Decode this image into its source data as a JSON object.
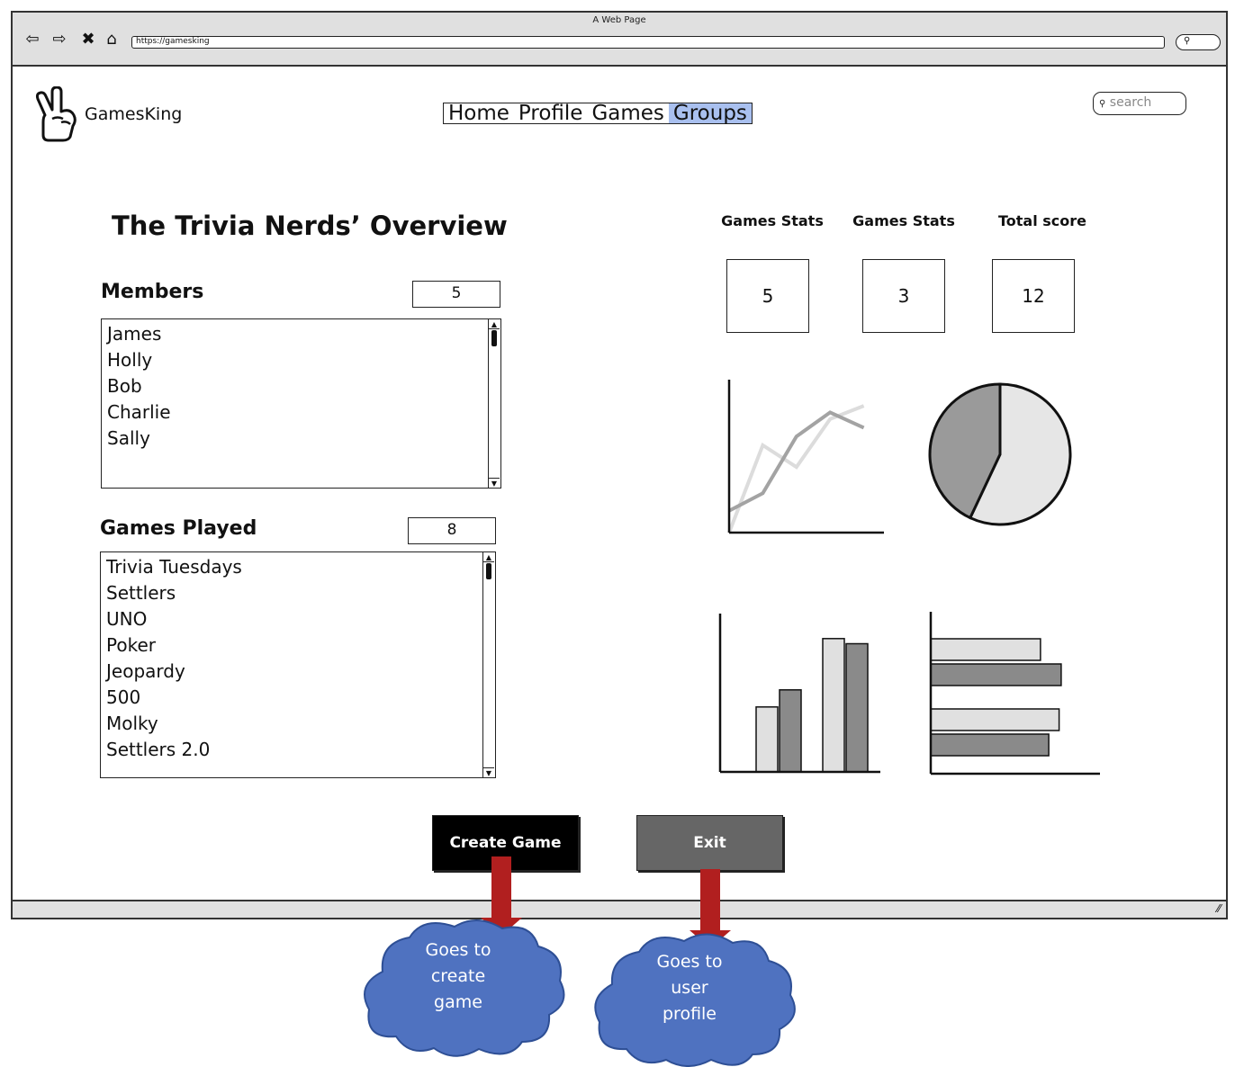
{
  "window": {
    "title": "A Web Page",
    "url": "https://gamesking"
  },
  "header": {
    "brand": "GamesKing",
    "nav": [
      {
        "label": "Home",
        "active": false
      },
      {
        "label": "Profile",
        "active": false
      },
      {
        "label": "Games",
        "active": false
      },
      {
        "label": "Groups",
        "active": true
      }
    ],
    "search_placeholder": "search"
  },
  "main": {
    "title": "The Trivia Nerds’ Overview",
    "members": {
      "label": "Members",
      "count": "5",
      "items": [
        "James",
        "Holly",
        "Bob",
        "Charlie",
        "Sally"
      ]
    },
    "games_played": {
      "label": "Games Played",
      "count": "8",
      "items": [
        "Trivia Tuesdays",
        "Settlers",
        "UNO",
        "Poker",
        "Jeopardy",
        "500",
        "Molky",
        "Settlers 2.0"
      ]
    },
    "stats": [
      {
        "label": "Games Stats",
        "value": "5"
      },
      {
        "label": "Games Stats",
        "value": "3"
      },
      {
        "label": "Total score",
        "value": "12"
      }
    ]
  },
  "actions": {
    "create_game": "Create Game",
    "exit": "Exit"
  },
  "annotations": {
    "create_game_note": [
      "Goes to",
      "create",
      "game"
    ],
    "exit_note": [
      "Goes to",
      "user",
      "profile"
    ]
  },
  "chart_data": [
    {
      "type": "line",
      "series": [
        {
          "values": [
            10,
            18,
            44,
            55,
            48
          ]
        },
        {
          "values": [
            0,
            40,
            30,
            52,
            58
          ]
        }
      ]
    },
    {
      "type": "pie",
      "values": [
        57,
        43
      ],
      "colors": [
        "#e6e6e6",
        "#9a9a9a"
      ]
    },
    {
      "type": "bar",
      "series": [
        {
          "values": [
            38,
            78
          ]
        },
        {
          "values": [
            48,
            75
          ]
        }
      ],
      "colors": [
        "#e0e0e0",
        "#8a8a8a"
      ]
    },
    {
      "type": "bar",
      "orientation": "horizontal",
      "series": [
        {
          "values": [
            53,
            62
          ]
        },
        {
          "values": [
            63,
            57
          ]
        }
      ],
      "colors": [
        "#e0e0e0",
        "#8a8a8a"
      ]
    }
  ],
  "colors": {
    "nav_active": "#a9c0ef",
    "create_button": "#000000",
    "exit_button": "#666666",
    "arrow": "#b11f1f",
    "cloud": "#4f72c0"
  },
  "icons": [
    "back-arrow-icon",
    "forward-arrow-icon",
    "close-icon",
    "home-icon",
    "search-icon",
    "peace-hand-logo-icon",
    "resize-grip-icon"
  ]
}
